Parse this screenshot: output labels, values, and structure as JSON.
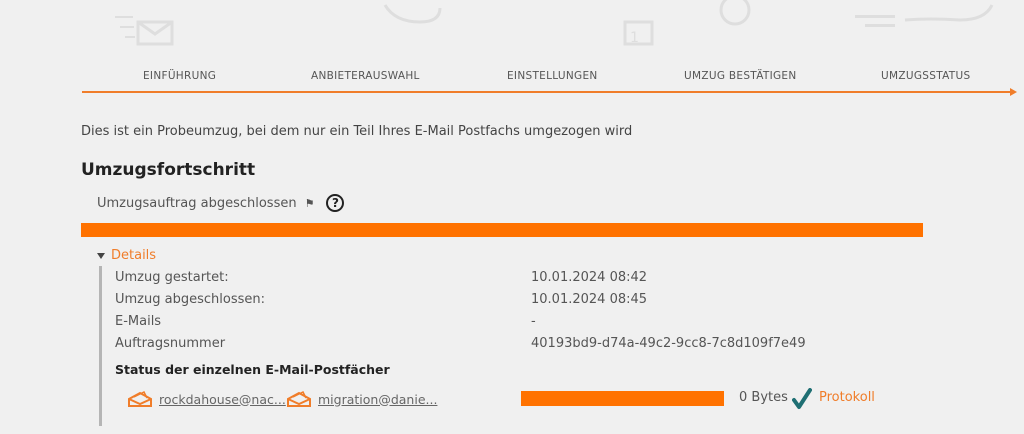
{
  "steps": [
    "EINFÜHRUNG",
    "ANBIETERAUSWAHL",
    "EINSTELLUNGEN",
    "UMZUG BESTÄTIGEN",
    "UMZUGSSTATUS"
  ],
  "notice": "Dies ist ein Probeumzug, bei dem nur ein Teil Ihres E-Mail Postfachs umgezogen wird",
  "section_title": "Umzugsfortschritt",
  "status": {
    "text": "Umzugsauftrag abgeschlossen",
    "flag_icon": "⚑",
    "help_icon": "?"
  },
  "progress": {
    "fraction": 1.0
  },
  "details": {
    "toggle_label": "Details",
    "rows": [
      {
        "label": "Umzug gestartet:",
        "value": "10.01.2024 08:42"
      },
      {
        "label": "Umzug abgeschlossen:",
        "value": "10.01.2024 08:45"
      },
      {
        "label": "E-Mails",
        "value": "-"
      },
      {
        "label": "Auftragsnummer",
        "value": "40193bd9-d74a-49c2-9cc8-7c8d109f7e49"
      }
    ],
    "mailbox_section_title": "Status der einzelnen E-Mail-Postfächer",
    "mailboxes": [
      {
        "name": "rockdahouse@nac..."
      },
      {
        "name": "migration@danie..."
      }
    ],
    "mailbox_progress": {
      "fraction": 1.0
    },
    "bytes": "0 Bytes",
    "protokoll": "Protokoll"
  },
  "colors": {
    "accent": "#f07d2a",
    "progress": "#ff7200",
    "check": "#1f6f73"
  }
}
